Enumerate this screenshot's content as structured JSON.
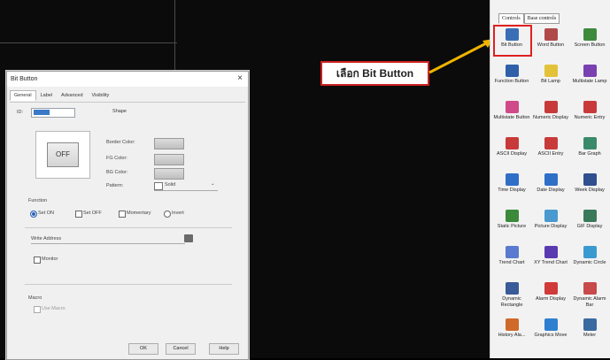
{
  "dialog": {
    "title": "Bit Button",
    "close": "×",
    "tabs": [
      "General",
      "Label",
      "Advanced",
      "Visibility"
    ],
    "id_label": "ID:",
    "shape_label": "Shape",
    "preview_label": "OFF",
    "border_color_label": "Border Color:",
    "fg_color_label": "FG Color:",
    "bg_color_label": "BG Color:",
    "pattern_label": "Pattern:",
    "pattern_value": "Solid",
    "function_label": "Function",
    "functions": [
      "Set ON",
      "Set OFF",
      "Momentary",
      "Invert"
    ],
    "function_selected": "Set ON",
    "write_address_label": "Write Address",
    "monitor_label": "Monitor",
    "macro_label": "Macro",
    "use_macro_label": "Use Macro",
    "ok_label": "OK",
    "cancel_label": "Cancel",
    "help_label": "Help"
  },
  "callout": {
    "text": "เลือก Bit Button",
    "arrow_color": "#f0b400"
  },
  "panel": {
    "tabs": [
      "Controls",
      "Base controls"
    ],
    "items": [
      {
        "label": "Bit Button",
        "icon": "bit-button-icon",
        "color": "#3a6fb5"
      },
      {
        "label": "Word Button",
        "icon": "word-button-icon",
        "color": "#b04a4a"
      },
      {
        "label": "Screen Button",
        "icon": "screen-button-icon",
        "color": "#3d8a3d"
      },
      {
        "label": "Function Button",
        "icon": "function-button-icon",
        "color": "#2f5fa8"
      },
      {
        "label": "Bit Lamp",
        "icon": "bit-lamp-icon",
        "color": "#e3c23a"
      },
      {
        "label": "Multistate Lamp",
        "icon": "multistate-lamp-icon",
        "color": "#7a3fb0"
      },
      {
        "label": "Multistate Button",
        "icon": "multistate-button-icon",
        "color": "#d04a8a"
      },
      {
        "label": "Numeric Display",
        "icon": "numeric-display-icon",
        "color": "#c83a3a"
      },
      {
        "label": "Numeric Entry",
        "icon": "numeric-entry-icon",
        "color": "#c83a3a"
      },
      {
        "label": "ASCII Display",
        "icon": "ascii-display-icon",
        "color": "#c83a3a"
      },
      {
        "label": "ASCII Entry",
        "icon": "ascii-entry-icon",
        "color": "#c83a3a"
      },
      {
        "label": "Bar Graph",
        "icon": "bar-graph-icon",
        "color": "#3a8a6a"
      },
      {
        "label": "Time Display",
        "icon": "time-display-icon",
        "color": "#2f6fc8"
      },
      {
        "label": "Date Display",
        "icon": "date-display-icon",
        "color": "#2f6fc8"
      },
      {
        "label": "Week Display",
        "icon": "week-display-icon",
        "color": "#2f4f8f"
      },
      {
        "label": "Static Picture",
        "icon": "static-picture-icon",
        "color": "#3a8a3a"
      },
      {
        "label": "Picture Display",
        "icon": "picture-display-icon",
        "color": "#4a9ad0"
      },
      {
        "label": "GIF Display",
        "icon": "gif-display-icon",
        "color": "#3a7a5a"
      },
      {
        "label": "Trend Chart",
        "icon": "trend-chart-icon",
        "color": "#5a7ad0"
      },
      {
        "label": "XY Trend Chart",
        "icon": "xy-trend-chart-icon",
        "color": "#5a3ab0"
      },
      {
        "label": "Dynamic Circle",
        "icon": "dynamic-circle-icon",
        "color": "#3a9ad0"
      },
      {
        "label": "Dynamic Rectangle",
        "icon": "dynamic-rectangle-icon",
        "color": "#3a5a9a"
      },
      {
        "label": "Alarm Display",
        "icon": "alarm-display-icon",
        "color": "#d03a3a"
      },
      {
        "label": "Dynamic Alarm Bar",
        "icon": "dynamic-alarm-bar-icon",
        "color": "#c84a4a"
      },
      {
        "label": "History Ala...",
        "icon": "history-alarm-icon",
        "color": "#d06a2a"
      },
      {
        "label": "Graphics Move",
        "icon": "graphics-move-icon",
        "color": "#2f7fd0"
      },
      {
        "label": "Meter",
        "icon": "meter-icon",
        "color": "#3a6aa0"
      }
    ]
  }
}
